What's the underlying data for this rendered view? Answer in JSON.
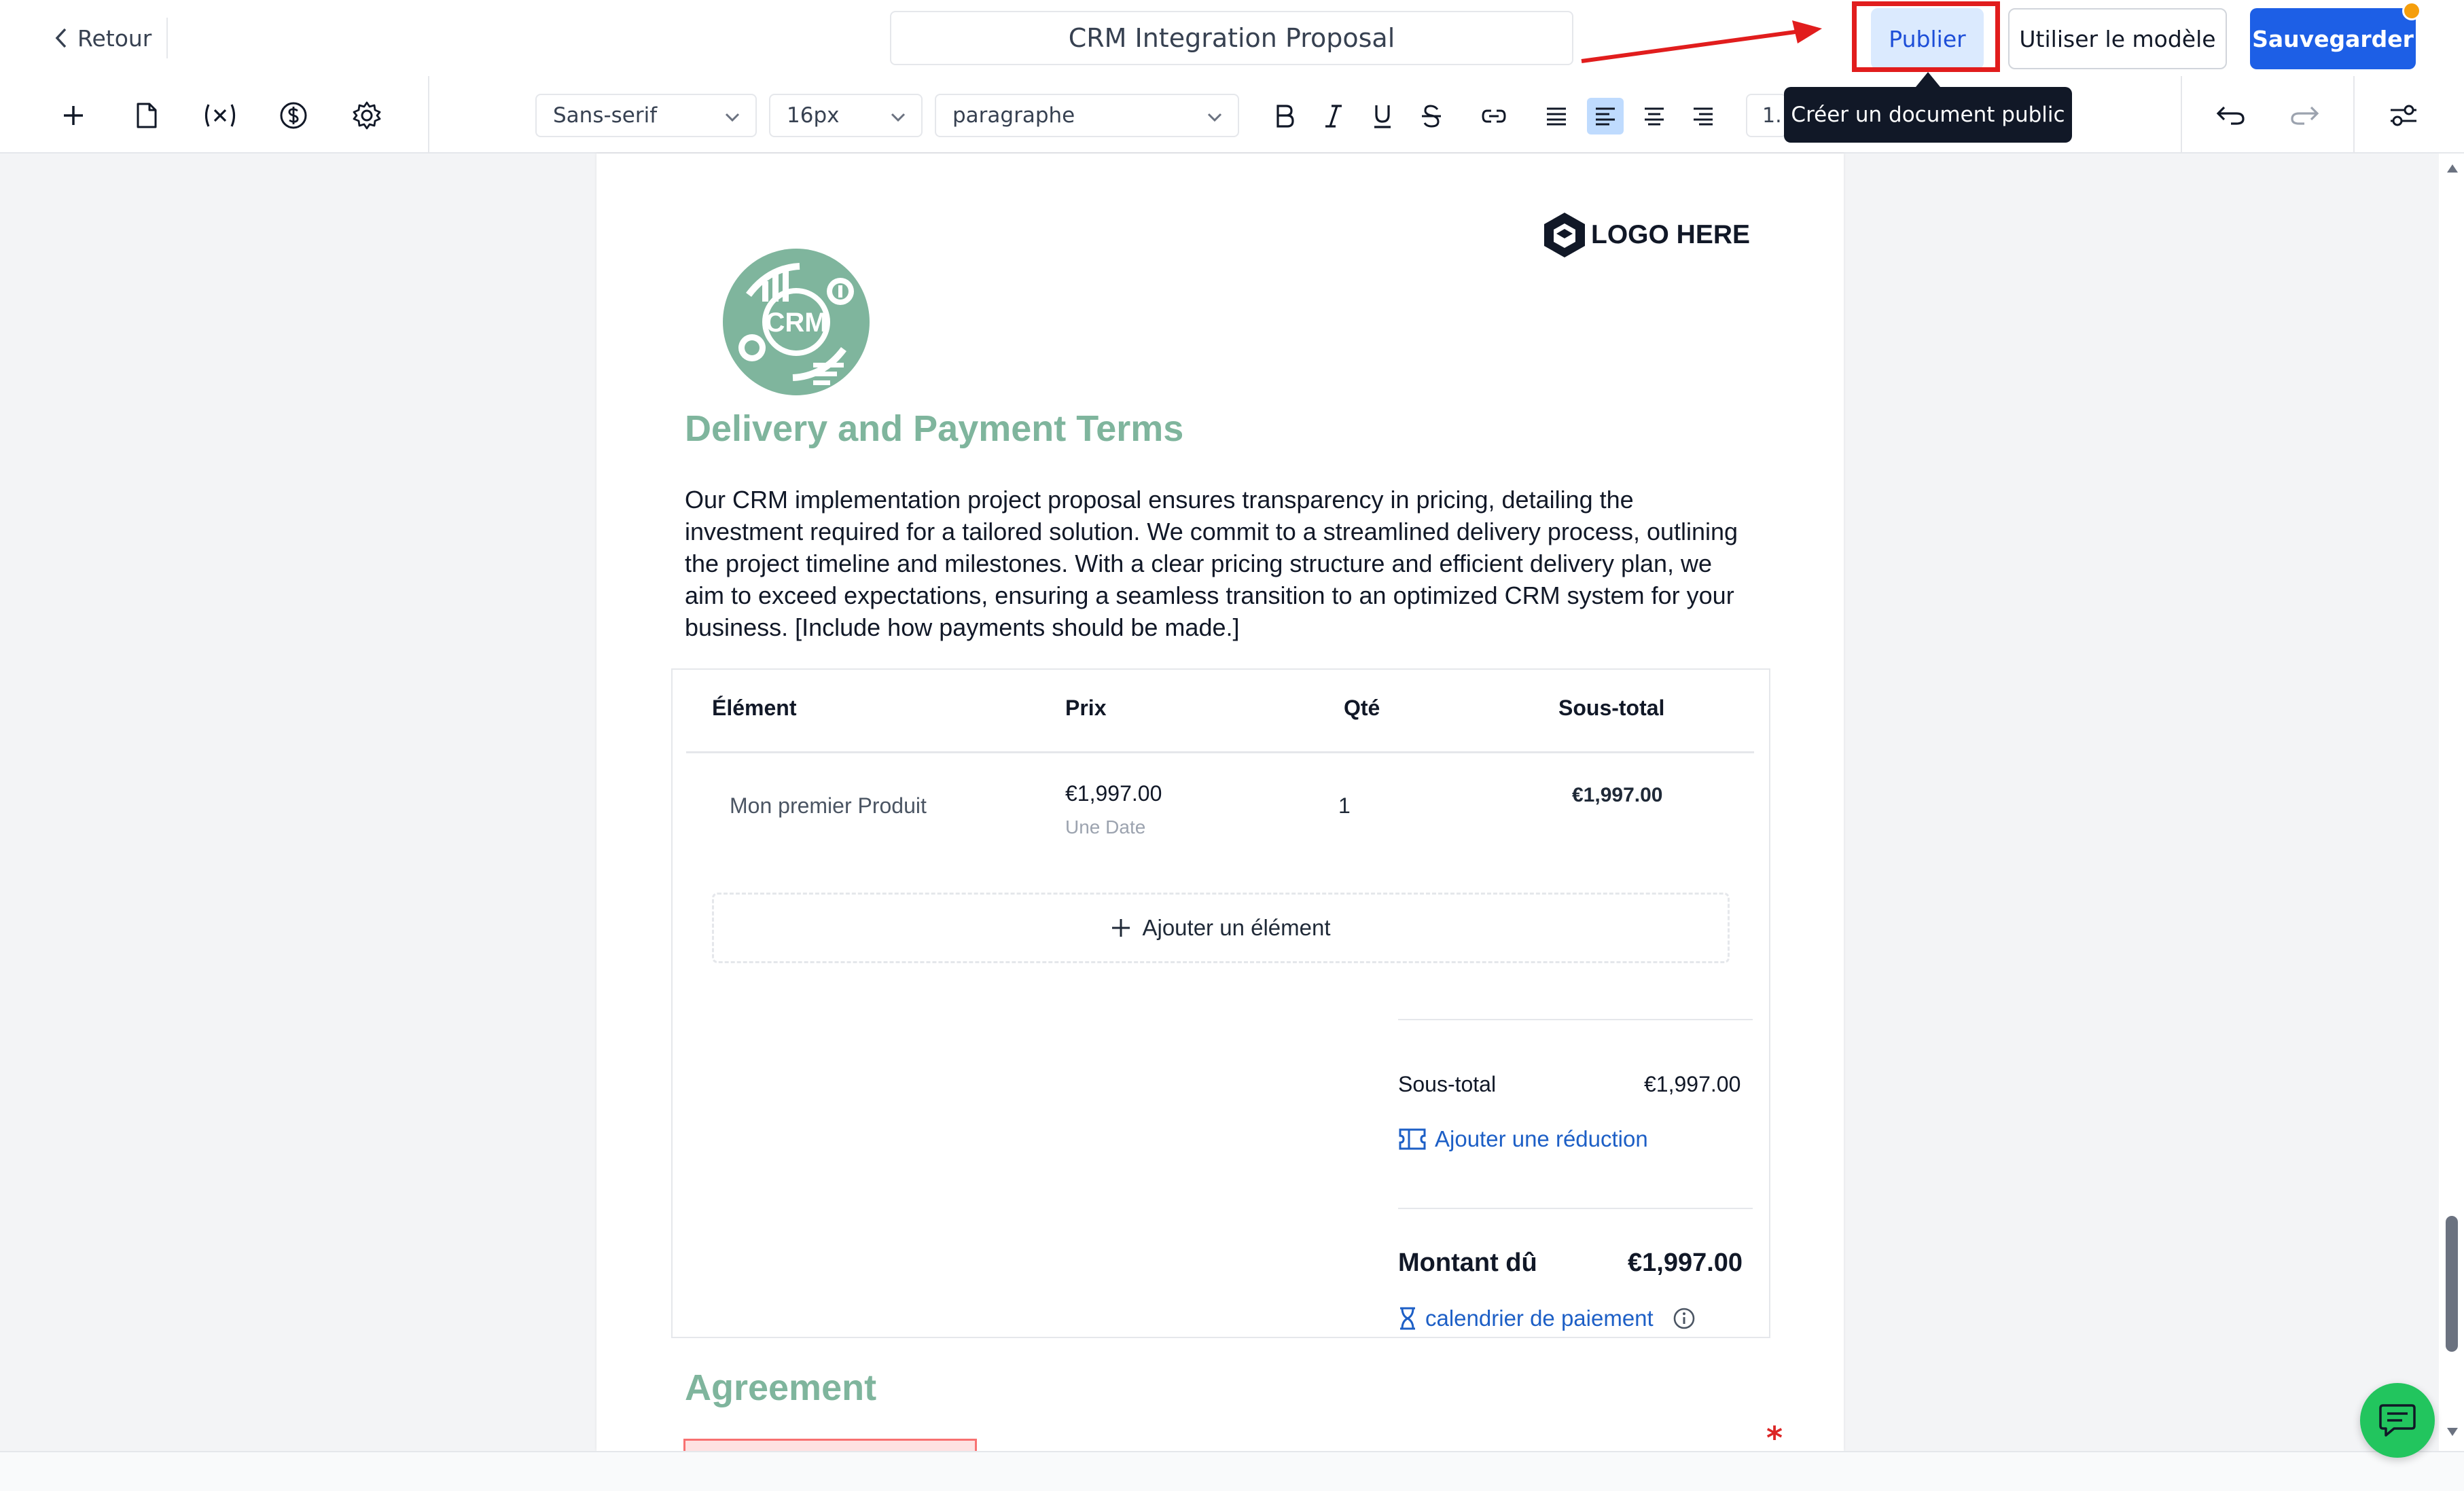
{
  "header": {
    "back_label": "Retour",
    "document_title": "CRM Integration Proposal",
    "publish_label": "Publier",
    "use_template_label": "Utiliser le modèle",
    "save_label": "Sauvegarder",
    "publish_tooltip": "Créer un document public"
  },
  "toolbar": {
    "font_family": "Sans-serif",
    "font_size": "16px",
    "block_type": "paragraphe",
    "line_height": "1."
  },
  "document": {
    "logo_text": "LOGO HERE",
    "crm_logo_text": "CRM",
    "section_title": "Delivery and Payment Terms",
    "intro": "Our CRM implementation project proposal ensures transparency in pricing, detailing the investment required for a tailored solution. We commit to a streamlined delivery process, outlining the project timeline and milestones. With a clear pricing structure and efficient delivery plan, we aim to exceed expectations, ensuring a seamless transition to an optimized CRM system for your business. [Include how payments should be made.]",
    "table": {
      "headers": [
        "Élément",
        "Prix",
        "Qté",
        "Sous-total"
      ],
      "rows": [
        {
          "item": "Mon premier Produit",
          "price": "€1,997.00",
          "date": "Une Date",
          "qty": "1",
          "subtotal": "€1,997.00"
        }
      ],
      "add_item_label": "Ajouter un élément"
    },
    "summary": {
      "subtotal_label": "Sous-total",
      "subtotal_value": "€1,997.00",
      "discount_label": "Ajouter une réduction",
      "amount_due_label": "Montant dû",
      "amount_due_value": "€1,997.00",
      "schedule_label": "calendrier de paiement"
    },
    "agreement_title": "Agreement",
    "required_mark": "*"
  },
  "colors": {
    "accent": "#1d5fe6",
    "heading_green": "#7fb59d",
    "highlight_red": "#e11d1d",
    "chat_green": "#22c55e"
  }
}
